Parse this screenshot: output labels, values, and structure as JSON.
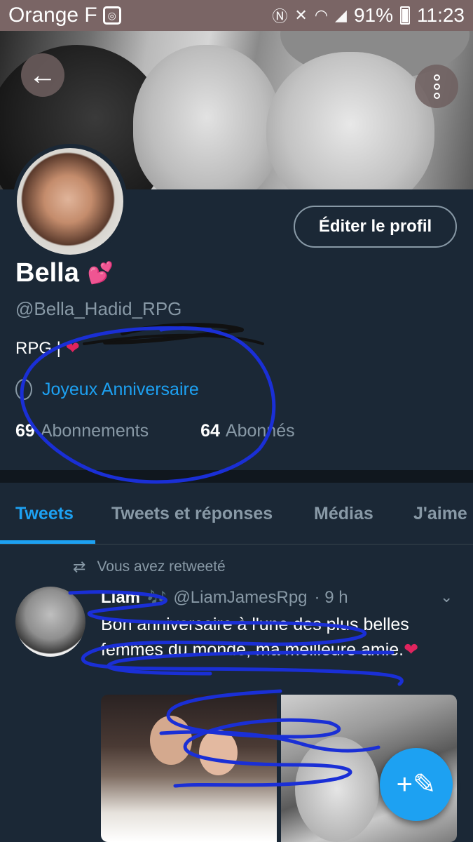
{
  "status_bar": {
    "carrier": "Orange F",
    "battery": "91%",
    "time": "11:23"
  },
  "header": {
    "back_icon": "arrow-left-icon",
    "more_icon": "more-vertical-icon"
  },
  "profile": {
    "edit_button": "Éditer le profil",
    "name": "Bella",
    "name_emoji": "💕",
    "handle": "@Bella_Hadid_RPG",
    "bio": "RPG | ",
    "bio_heart": "❤",
    "birthday": "Joyeux Anniversaire",
    "following_count": "69",
    "following_label": "Abonnements",
    "followers_count": "64",
    "followers_label": "Abonnés"
  },
  "tabs": [
    "Tweets",
    "Tweets et réponses",
    "Médias",
    "J'aime"
  ],
  "active_tab": "Tweets",
  "tweet": {
    "retweet_label": "Vous avez retweeté",
    "author_name": "Liam",
    "author_emoji": "🎶",
    "author_handle": "@LiamJamesRpg",
    "time": "· 9 h",
    "text": "Bon anniversaire à l'une des plus belles femmes du monde, ma meilleure amie.",
    "text_emoji": "❤"
  },
  "colors": {
    "background": "#1b2836",
    "accent": "#1da1f2",
    "muted": "#8899a6",
    "status_bar": "#7a6565",
    "scribble": "#1a2fd6"
  }
}
